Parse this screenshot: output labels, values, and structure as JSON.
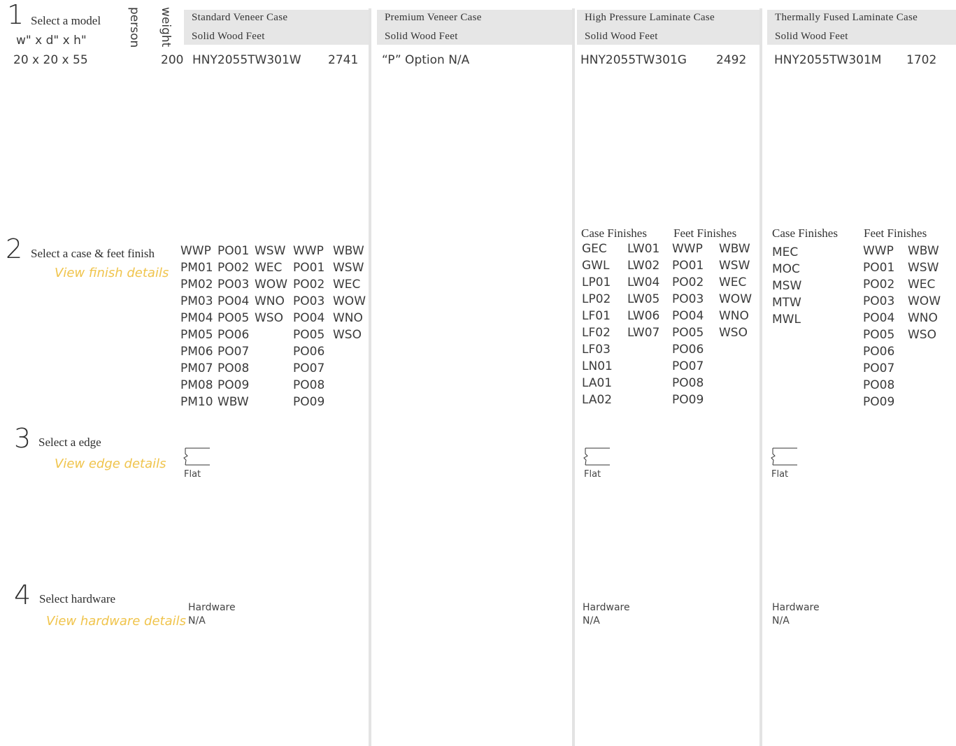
{
  "steps": {
    "model": {
      "number": "1",
      "title": "Select a model",
      "dims_label": "w\" x d\" x h\"",
      "person_label": "person",
      "weight_label": "weight",
      "dims_value": "20 x 20 x 55",
      "person_value": "200"
    },
    "finish": {
      "number": "2",
      "title": "Select a case & feet finish",
      "link": "View finish details"
    },
    "edge": {
      "number": "3",
      "title": "Select a edge",
      "link": "View edge details"
    },
    "hardware": {
      "number": "4",
      "title": "Select hardware",
      "link": "View hardware details"
    }
  },
  "columns": {
    "standard": {
      "title": "Standard Veneer Case",
      "subtitle": "Solid Wood Feet",
      "model": "HNY2055TW301W",
      "price": "2741",
      "finishes": {
        "col1": [
          "WWP",
          "PM01",
          "PM02",
          "PM03",
          "PM04",
          "PM05",
          "PM06",
          "PM07",
          "PM08",
          "PM10"
        ],
        "col2": [
          "PO01",
          "PO02",
          "PO03",
          "PO04",
          "PO05",
          "PO06",
          "PO07",
          "PO08",
          "PO09",
          "WBW"
        ],
        "col3": [
          "WSW",
          "WEC",
          "WOW",
          "WNO",
          "WSO"
        ],
        "col4": [
          "WWP",
          "PO01",
          "PO02",
          "PO03",
          "PO04",
          "PO05",
          "PO06",
          "PO07",
          "PO08",
          "PO09"
        ],
        "col5": [
          "WBW",
          "WSW",
          "WEC",
          "WOW",
          "WNO",
          "WSO"
        ]
      },
      "edge": "Flat",
      "hardware_label": "Hardware",
      "hardware_value": "N/A"
    },
    "premium": {
      "title": "Premium Veneer Case",
      "subtitle": "Solid Wood Feet",
      "note": "“P” Option N/A"
    },
    "hpl": {
      "title": "High Pressure Laminate Case",
      "subtitle": "Solid Wood Feet",
      "model": "HNY2055TW301G",
      "price": "2492",
      "case_finishes_title": "Case Finishes",
      "feet_finishes_title": "Feet Finishes",
      "case_col1": [
        "GEC",
        "GWL",
        "LP01",
        "LP02",
        "LF01",
        "LF02",
        "LF03",
        "LN01",
        "LA01",
        "LA02"
      ],
      "case_col2": [
        "LW01",
        "LW02",
        "LW04",
        "LW05",
        "LW06",
        "LW07"
      ],
      "feet_col1": [
        "WWP",
        "PO01",
        "PO02",
        "PO03",
        "PO04",
        "PO05",
        "PO06",
        "PO07",
        "PO08",
        "PO09"
      ],
      "feet_col2": [
        "WBW",
        "WSW",
        "WEC",
        "WOW",
        "WNO",
        "WSO"
      ],
      "edge": "Flat",
      "hardware_label": "Hardware",
      "hardware_value": "N/A"
    },
    "tfl": {
      "title": "Thermally Fused Laminate Case",
      "subtitle": "Solid Wood Feet",
      "model": "HNY2055TW301M",
      "price": "1702",
      "case_finishes_title": "Case Finishes",
      "feet_finishes_title": "Feet Finishes",
      "case_col1": [
        "MEC",
        "MOC",
        "MSW",
        "MTW",
        "MWL"
      ],
      "feet_col1": [
        "WWP",
        "PO01",
        "PO02",
        "PO03",
        "PO04",
        "PO05",
        "PO06",
        "PO07",
        "PO08",
        "PO09"
      ],
      "feet_col2": [
        "WBW",
        "WSW",
        "WEC",
        "WOW",
        "WNO",
        "WSO"
      ],
      "edge": "Flat",
      "hardware_label": "Hardware",
      "hardware_value": "N/A"
    }
  },
  "colors": {
    "accent_link": "#f0c44c",
    "header_bg": "#e6e6e6",
    "divider": "#e3e3e3"
  }
}
